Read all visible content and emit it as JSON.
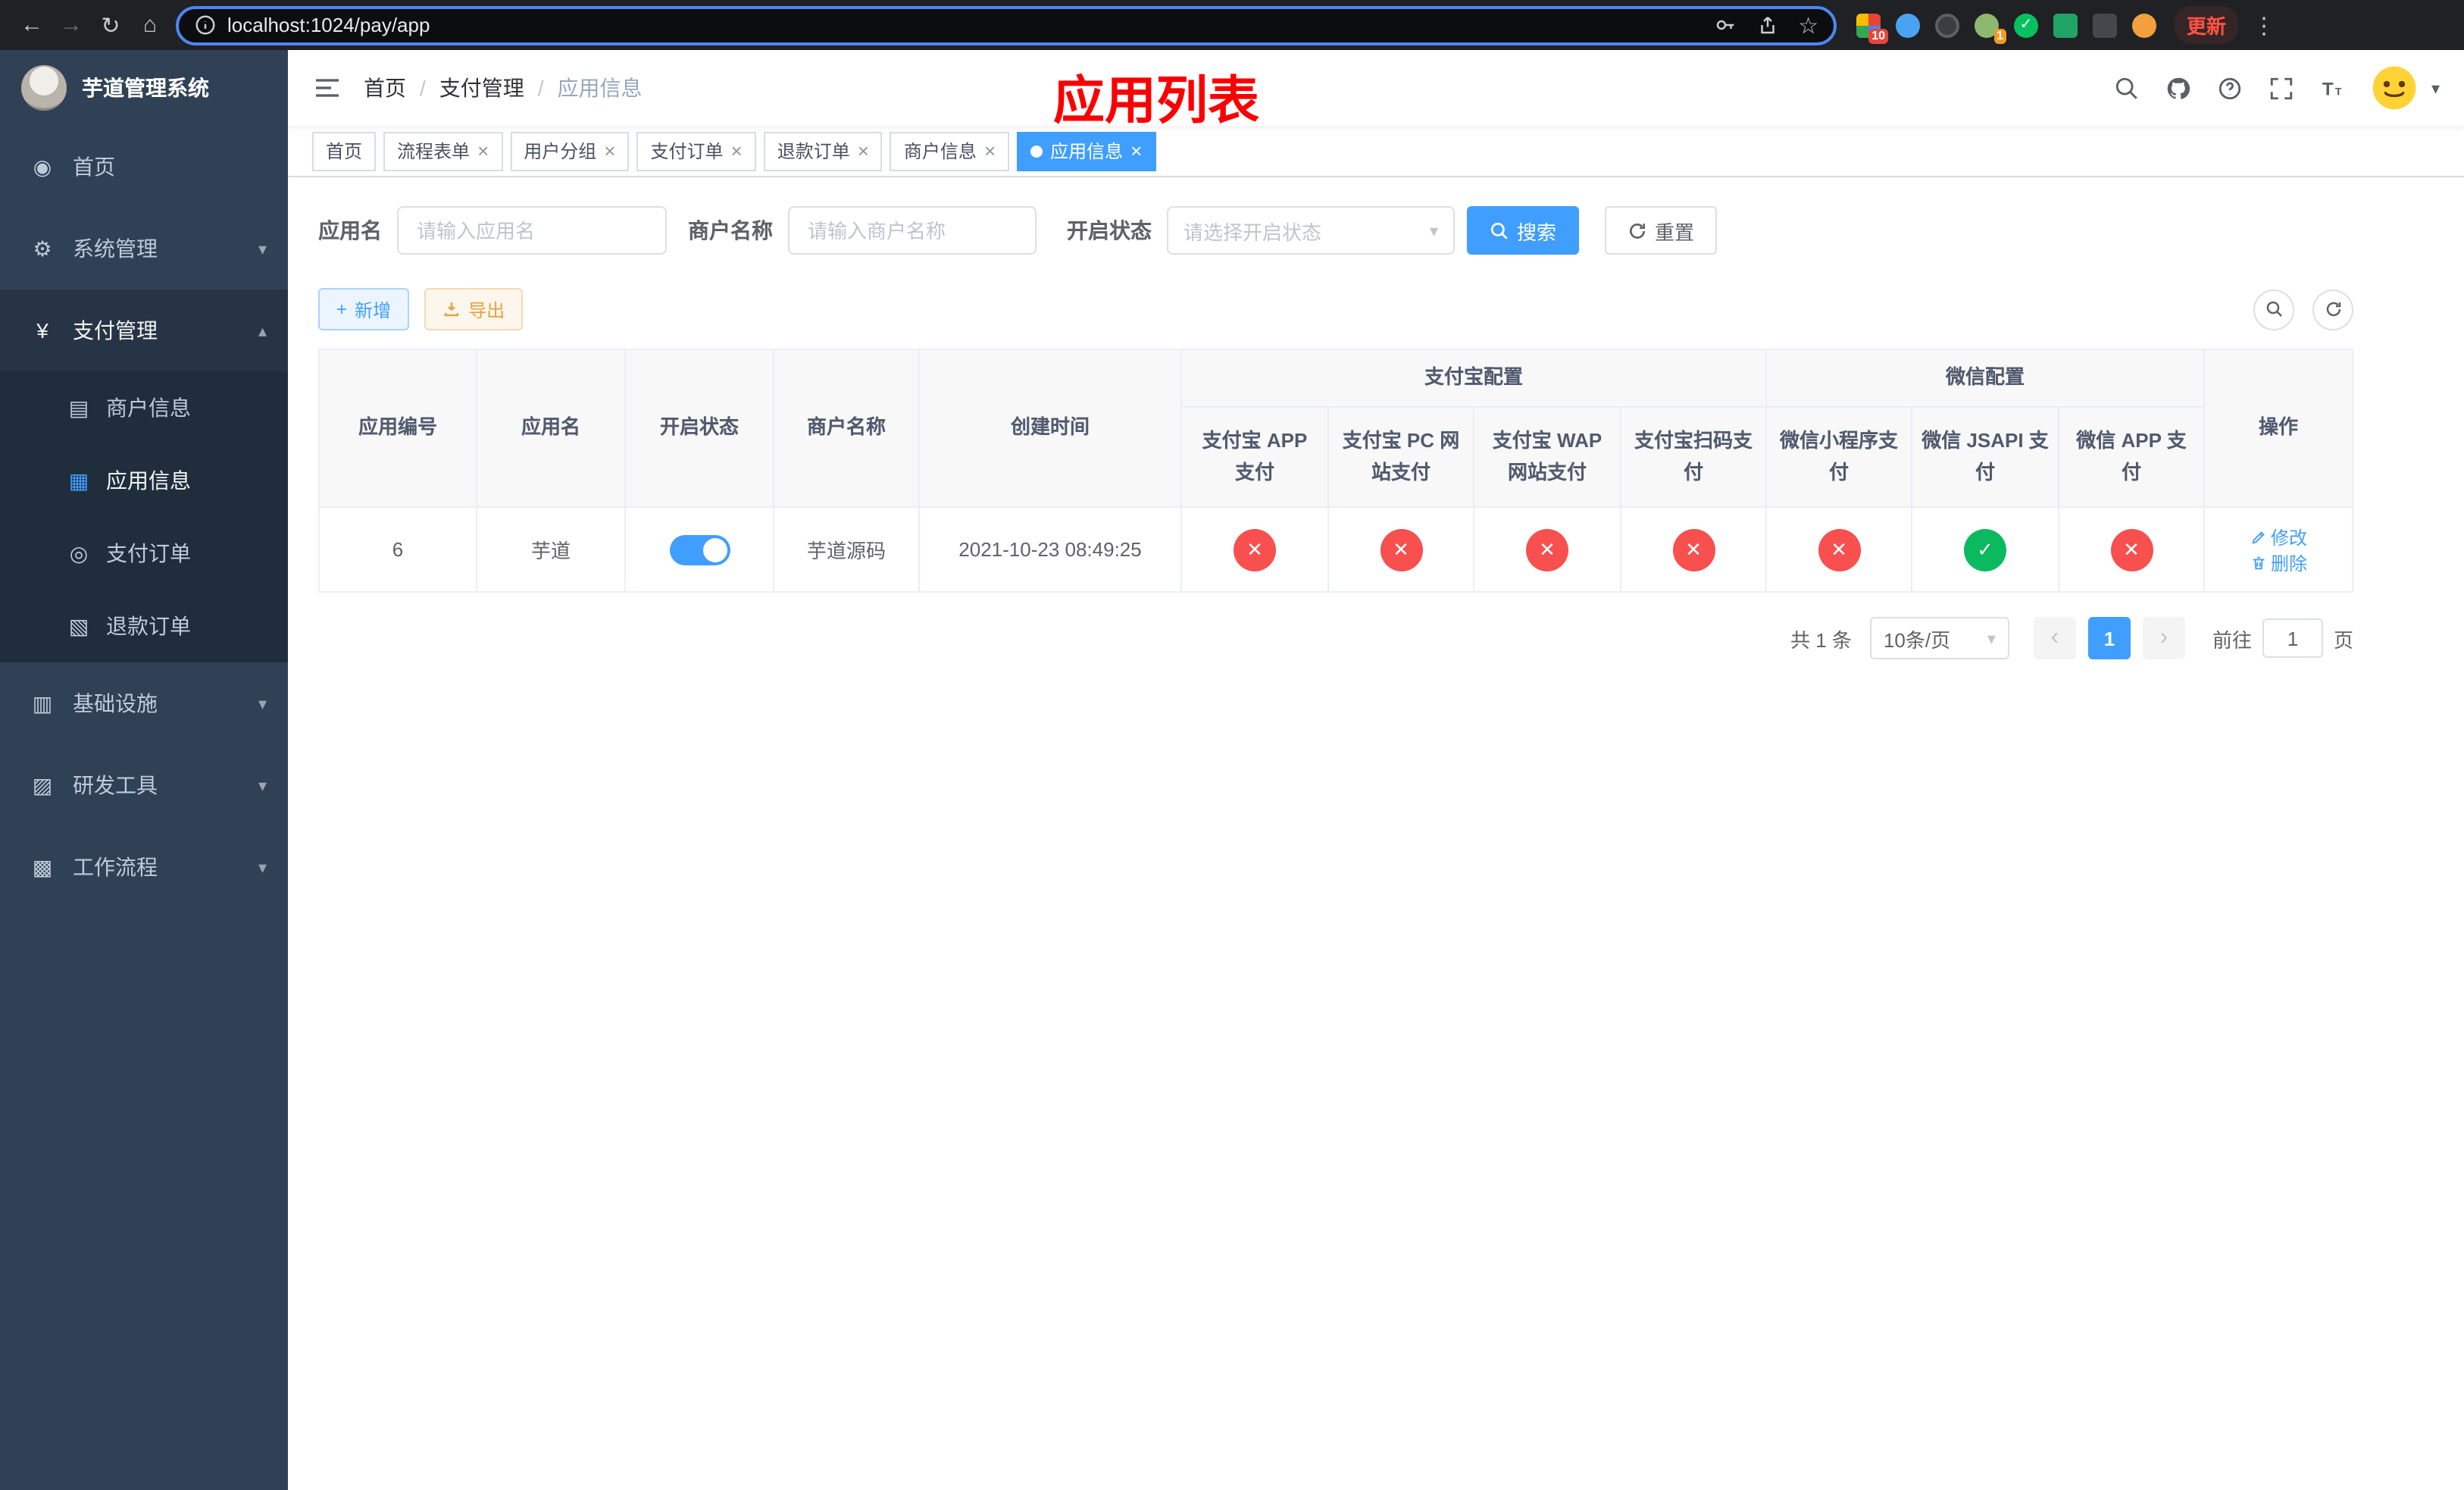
{
  "colors": {
    "accent": "#409eff",
    "danger": "#f7504f",
    "success": "#0bb95f",
    "warning": "#e6a23c",
    "annotation_red": "#fb0000",
    "sidebar_bg": "#304156",
    "sidebar_sub_bg": "#1f2d3d"
  },
  "icons": {
    "back": "←",
    "forward": "→",
    "reload": "↻",
    "home": "⌂",
    "menu": "⋮",
    "star": "☆",
    "caret_down": "▾",
    "chevron_down": "▾",
    "chevron_up": "▴",
    "tab_close": "×",
    "plus": "+",
    "prev": "‹",
    "next": "›",
    "check": "✓",
    "cross": "✕"
  },
  "browser": {
    "url": "localhost:1024/pay/app",
    "update": "更新",
    "badge_red": "10",
    "badge_orange": "1"
  },
  "sidebar": {
    "title": "芋道管理系统",
    "items": [
      {
        "label": "首页",
        "glyph": "◉"
      },
      {
        "label": "系统管理",
        "glyph": "⚙"
      },
      {
        "label": "支付管理",
        "glyph": "¥",
        "children": [
          {
            "label": "商户信息",
            "glyph": "▤"
          },
          {
            "label": "应用信息",
            "glyph": "▦"
          },
          {
            "label": "支付订单",
            "glyph": "◎"
          },
          {
            "label": "退款订单",
            "glyph": "▧"
          }
        ]
      },
      {
        "label": "基础设施",
        "glyph": "▥"
      },
      {
        "label": "研发工具",
        "glyph": "▨"
      },
      {
        "label": "工作流程",
        "glyph": "▩"
      }
    ]
  },
  "header": {
    "breadcrumb": [
      "首页",
      "支付管理",
      "应用信息"
    ],
    "separator": "/",
    "annotation": "应用列表"
  },
  "tabs": [
    {
      "label": "首页"
    },
    {
      "label": "流程表单"
    },
    {
      "label": "用户分组"
    },
    {
      "label": "支付订单"
    },
    {
      "label": "退款订单"
    },
    {
      "label": "商户信息"
    },
    {
      "label": "应用信息"
    }
  ],
  "filters": {
    "app_name_label": "应用名",
    "app_name_placeholder": "请输入应用名",
    "merchant_label": "商户名称",
    "merchant_placeholder": "请输入商户名称",
    "status_label": "开启状态",
    "status_placeholder": "请选择开启状态",
    "search": "搜索",
    "reset": "重置"
  },
  "toolbar": {
    "add": "新增",
    "export": "导出"
  },
  "table": {
    "groups": {
      "alipay": "支付宝配置",
      "wechat": "微信配置"
    },
    "headers": {
      "app_id": "应用编号",
      "app_name": "应用名",
      "status": "开启状态",
      "merchant_name": "商户名称",
      "create_time": "创建时间",
      "alipay_app": "支付宝 APP 支付",
      "alipay_pc": "支付宝 PC 网站支付",
      "alipay_wap": "支付宝 WAP 网站支付",
      "alipay_qr": "支付宝扫码支付",
      "wx_lite": "微信小程序支付",
      "wx_jsapi": "微信 JSAPI 支付",
      "wx_app": "微信 APP 支付",
      "actions": "操作"
    },
    "row": {
      "app_id": "6",
      "app_name": "芋道",
      "status_on": true,
      "merchant_name": "芋道源码",
      "create_time": "2021-10-23 08:49:25",
      "configs": [
        "no",
        "no",
        "no",
        "no",
        "no",
        "yes",
        "no"
      ],
      "edit_label": "修改",
      "delete_label": "删除"
    }
  },
  "pagination": {
    "total": "共 1 条",
    "page_size": "10条/页",
    "page": "1",
    "goto": "前往",
    "goto_value": "1",
    "unit": "页"
  }
}
